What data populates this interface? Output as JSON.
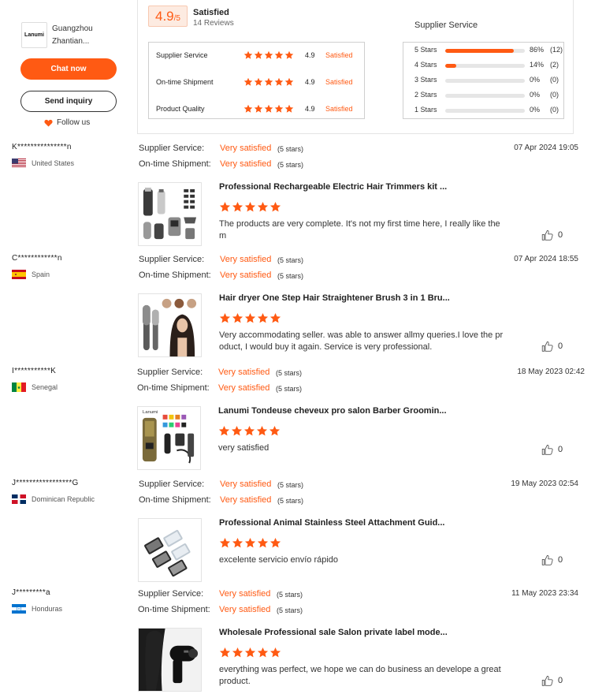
{
  "supplier": {
    "logo_text": "Lanumi",
    "name_line1": "Guangzhou",
    "name_line2": "Zhantian...",
    "chat_label": "Chat now",
    "inquiry_label": "Send inquiry",
    "follow_label": "Follow us"
  },
  "summary": {
    "score": "4.9",
    "score_suffix": "/5",
    "status": "Satisfied",
    "reviews_count": "14 Reviews",
    "dist_title": "Supplier Service",
    "categories": [
      {
        "label": "Supplier Service",
        "stars": 5,
        "score": "4.9",
        "status": "Satisfied"
      },
      {
        "label": "On-time Shipment",
        "stars": 5,
        "score": "4.9",
        "status": "Satisfied"
      },
      {
        "label": "Product Quality",
        "stars": 5,
        "score": "4.9",
        "status": "Satisfied"
      }
    ],
    "distribution": [
      {
        "label": "5 Stars",
        "fraction": 0.86,
        "pct": "86%",
        "count": "(12)"
      },
      {
        "label": "4 Stars",
        "fraction": 0.14,
        "pct": "14%",
        "count": "(2)"
      },
      {
        "label": "3 Stars",
        "fraction": 0,
        "pct": "0%",
        "count": "(0)"
      },
      {
        "label": "2 Stars",
        "fraction": 0,
        "pct": "0%",
        "count": "(0)"
      },
      {
        "label": "1 Stars",
        "fraction": 0,
        "pct": "0%",
        "count": "(0)"
      }
    ]
  },
  "reviews": [
    {
      "user": "K***************n",
      "country": "United States",
      "supplier_label": "Supplier Service:",
      "supplier_val": "Very satisfied",
      "supplier_stars": "(5 stars)",
      "shipment_label": "On-time Shipment:",
      "shipment_val": "Very satisfied",
      "shipment_stars": "(5 stars)",
      "date": "07 Apr 2024 19:05",
      "product_title": "Professional Rechargeable Electric Hair Trimmers kit ...",
      "product_stars": 5,
      "text": "The products are very complete. It's not my first time here, I really like the m",
      "likes": "0"
    },
    {
      "user": "C************n",
      "country": "Spain",
      "supplier_label": "Supplier Service:",
      "supplier_val": "Very satisfied",
      "supplier_stars": "(5 stars)",
      "shipment_label": "On-time Shipment:",
      "shipment_val": "Very satisfied",
      "shipment_stars": "(5 stars)",
      "date": "07 Apr 2024 18:55",
      "product_title": "Hair dryer One Step Hair Straightener Brush 3 in 1 Bru...",
      "product_stars": 5,
      "text": "Very accommodating seller. was able to answer allmy queries.I love the pr oduct, I would buy it again. Service is very professional.",
      "likes": "0"
    },
    {
      "user": "I***********K",
      "country": "Senegal",
      "supplier_label": "Supplier Service:",
      "supplier_val": "Very satisfied",
      "supplier_stars": "(5 stars)",
      "shipment_label": "On-time Shipment:",
      "shipment_val": "Very satisfied",
      "shipment_stars": "(5 stars)",
      "date": "18 May 2023 02:42",
      "product_title": "Lanumi Tondeuse cheveux pro salon Barber Groomin...",
      "product_stars": 5,
      "text": "very satisfied",
      "likes": "0"
    },
    {
      "user": "J*****************G",
      "country": "Dominican Republic",
      "supplier_label": "Supplier Service:",
      "supplier_val": "Very satisfied",
      "supplier_stars": "(5 stars)",
      "shipment_label": "On-time Shipment:",
      "shipment_val": "Very satisfied",
      "shipment_stars": "(5 stars)",
      "date": "19 May 2023 02:54",
      "product_title": "Professional Animal Stainless Steel Attachment Guid...",
      "product_stars": 5,
      "text": "excelente servicio envío rápido",
      "likes": "0"
    },
    {
      "user": "J*********a",
      "country": "Honduras",
      "supplier_label": "Supplier Service:",
      "supplier_val": "Very satisfied",
      "supplier_stars": "(5 stars)",
      "shipment_label": "On-time Shipment:",
      "shipment_val": "Very satisfied",
      "shipment_stars": "(5 stars)",
      "date": "11 May 2023 23:34",
      "product_title": "Wholesale Professional sale Salon private label mode...",
      "product_stars": 5,
      "text": "everything was perfect, we hope we can do business an develope a great product.",
      "likes": "0"
    }
  ],
  "colors": {
    "accent": "#ff5a13",
    "star": "#ff5a13",
    "bar_track": "#e6e6e6"
  }
}
